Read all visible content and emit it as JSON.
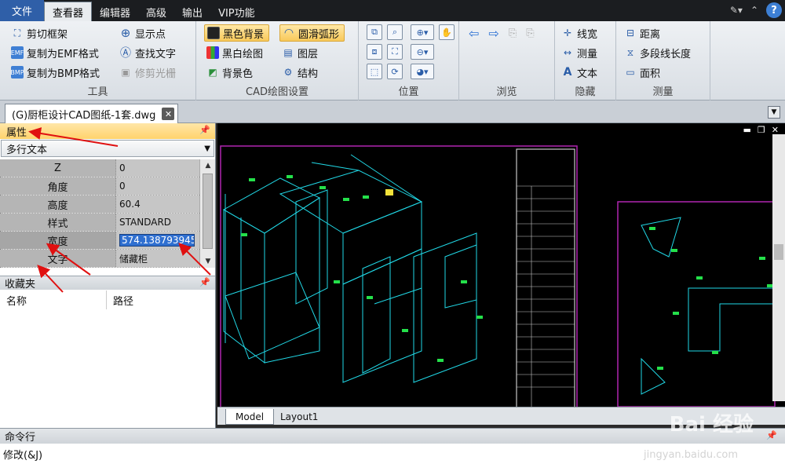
{
  "menubar": {
    "file": "文件",
    "tabs": [
      "查看器",
      "编辑器",
      "高级",
      "输出",
      "VIP功能"
    ],
    "active_tab": "查看器"
  },
  "ribbon": {
    "tools": {
      "title": "工具",
      "items": [
        "剪切框架",
        "复制为EMF格式",
        "复制为BMP格式",
        "显示点",
        "查找文字",
        "修剪光栅"
      ]
    },
    "cad_settings": {
      "title": "CAD绘图设置",
      "items": [
        "黑色背景",
        "黑白绘图",
        "背景色",
        "圆滑弧形",
        "图层",
        "结构"
      ]
    },
    "position": {
      "title": "位置"
    },
    "browse": {
      "title": "浏览"
    },
    "hide": {
      "title": "隐藏",
      "items": [
        "线宽",
        "测量",
        "文本"
      ]
    },
    "measure": {
      "title": "测量",
      "items": [
        "距离",
        "多段线长度",
        "面积"
      ]
    }
  },
  "document": {
    "tab_label": "(G)厨柜设计CAD图纸-1套.dwg"
  },
  "properties": {
    "title": "属性",
    "object_type": "多行文本",
    "rows": [
      {
        "name": "Z",
        "value": "0"
      },
      {
        "name": "角度",
        "value": "0"
      },
      {
        "name": "高度",
        "value": "60.4"
      },
      {
        "name": "样式",
        "value": "STANDARD"
      },
      {
        "name": "宽度",
        "value": "574.1387939453"
      },
      {
        "name": "文字",
        "value": "储藏柜"
      }
    ]
  },
  "favorites": {
    "title": "收藏夹",
    "columns": [
      "名称",
      "路径"
    ]
  },
  "layout_tabs": [
    "Model",
    "Layout1"
  ],
  "command": {
    "title": "命令行",
    "text": "修改(&J)"
  },
  "watermark": {
    "brand": "Bai 经验",
    "url": "jingyan.baidu.com"
  }
}
